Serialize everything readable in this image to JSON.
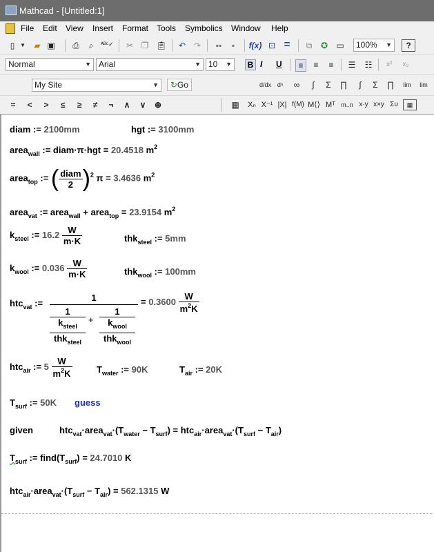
{
  "window": {
    "title": "Mathcad - [Untitled:1]"
  },
  "menu": [
    "File",
    "Edit",
    "View",
    "Insert",
    "Format",
    "Tools",
    "Symbolics",
    "Window",
    "Help"
  ],
  "toolbar": {
    "zoom": "100%"
  },
  "format": {
    "style": "Normal",
    "font": "Arial",
    "size": "10",
    "bold": "B",
    "italic": "I",
    "underline": "U"
  },
  "resource": {
    "site": "My Site",
    "go": "Go"
  },
  "operators": [
    "=",
    "<",
    ">",
    "≤",
    "≥",
    "≠",
    "¬",
    "∧",
    "∨",
    "⊕"
  ],
  "worksheet": {
    "diam_name": "diam",
    "diam_val": "2100mm",
    "hgt_name": "hgt",
    "hgt_val": "3100mm",
    "area": "area",
    "wall": "wall",
    "top": "top",
    "vat": "vat",
    "area_wall_result": "20.4518",
    "area_top_result": "3.4636",
    "area_vat_result": "23.9154",
    "m": "m",
    "two": "2",
    "pi": "π",
    "k": "k",
    "steel": "steel",
    "wool": "wool",
    "thk": "thk",
    "k_steel_val": "16.2",
    "k_wool_val": "0.036",
    "thk_steel_val": "5mm",
    "thk_wool_val": "100mm",
    "W": "W",
    "mK": "m·K",
    "K": "K",
    "m2K": "m",
    "htc": "htc",
    "air": "air",
    "one": "1",
    "htc_vat_result": "0.3600",
    "htc_air_val": "5",
    "T": "T",
    "water": "water",
    "surf": "surf",
    "T_water_val": "90K",
    "T_air_val": "20K",
    "T_surf_val": "50K",
    "guess": "guess",
    "given": "given",
    "find": "find",
    "find_result": "24.7010",
    "final_result": "562.1315"
  }
}
